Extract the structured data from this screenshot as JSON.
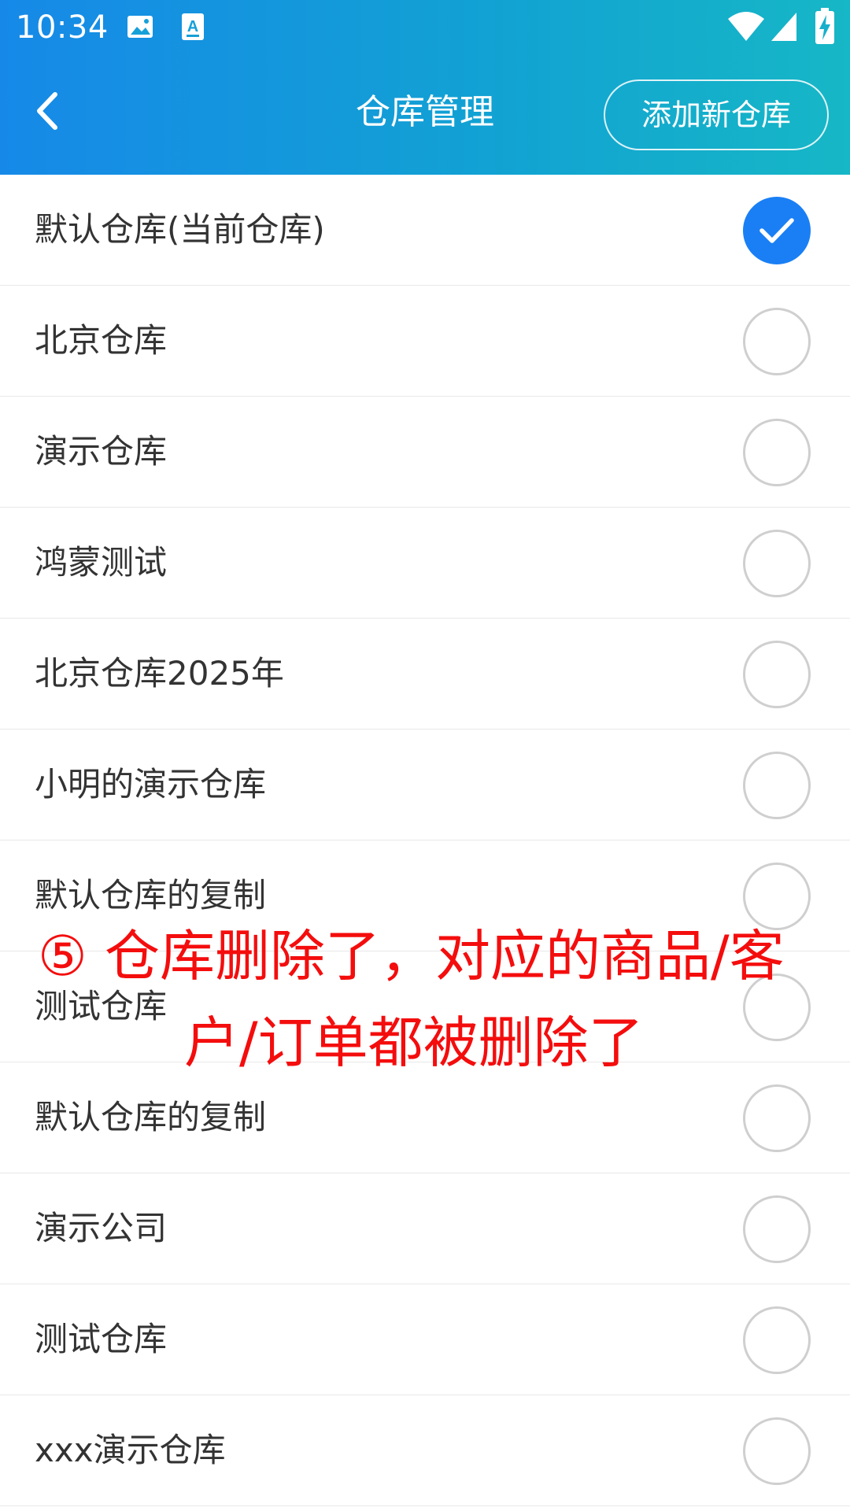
{
  "status_bar": {
    "time": "10:34",
    "left_icons": [
      "image-icon",
      "text-a-icon"
    ],
    "right_icons": [
      "wifi-icon",
      "signal-icon",
      "battery-charging-icon"
    ]
  },
  "header": {
    "title": "仓库管理",
    "add_button_label": "添加新仓库",
    "back_icon": "chevron-left-icon",
    "gradient": [
      "#1689e8",
      "#16b7c6"
    ]
  },
  "warehouses": [
    {
      "name": "默认仓库(当前仓库)",
      "selected": true
    },
    {
      "name": "北京仓库",
      "selected": false
    },
    {
      "name": "演示仓库",
      "selected": false
    },
    {
      "name": "鸿蒙测试",
      "selected": false
    },
    {
      "name": "北京仓库2025年",
      "selected": false
    },
    {
      "name": "小明的演示仓库",
      "selected": false
    },
    {
      "name": "默认仓库的复制",
      "selected": false
    },
    {
      "name": "测试仓库",
      "selected": false
    },
    {
      "name": "默认仓库的复制",
      "selected": false
    },
    {
      "name": "演示公司",
      "selected": false
    },
    {
      "name": "测试仓库",
      "selected": false
    },
    {
      "name": "xxx演示仓库",
      "selected": false
    }
  ],
  "annotation": {
    "line1": "⑤ 仓库删除了，对应的商品/客",
    "line2": "户/订单都被删除了",
    "color": "#f40d0d"
  },
  "colors": {
    "accent": "#1a7ff5",
    "radio_border": "#cfcfcf",
    "text": "#333333"
  }
}
